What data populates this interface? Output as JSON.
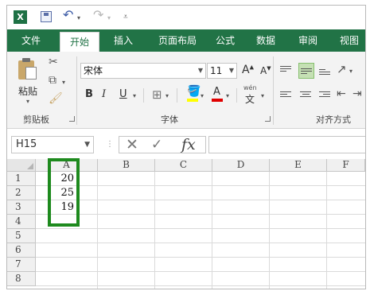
{
  "quick_access": {
    "logo": "X",
    "save_icon": "save-icon",
    "undo_icon": "undo-icon",
    "redo_icon": "redo-icon"
  },
  "tabs": [
    "文件",
    "开始",
    "插入",
    "页面布局",
    "公式",
    "数据",
    "审阅",
    "视图"
  ],
  "ribbon": {
    "clipboard": {
      "paste_label": "粘贴",
      "group_label": "剪贴板"
    },
    "font": {
      "font_name": "宋体",
      "font_size": "11",
      "grow_label": "A",
      "shrink_label": "A",
      "bold": "B",
      "italic": "I",
      "underline": "U",
      "font_color_label": "A",
      "phonetic_top": "wén",
      "phonetic_bottom": "文",
      "group_label": "字体",
      "fill_color": "#ffff00",
      "font_color": "#e00000"
    },
    "alignment": {
      "group_label": "对齐方式"
    }
  },
  "formula_bar": {
    "name_box": "H15",
    "cancel_icon": "✕",
    "enter_icon": "✓",
    "fx_label": "fx",
    "value": ""
  },
  "sheet": {
    "columns": [
      "A",
      "B",
      "C",
      "D",
      "E",
      "F"
    ],
    "rows": [
      "1",
      "2",
      "3",
      "4",
      "5",
      "6",
      "7",
      "8"
    ],
    "cells": {
      "A1": "20",
      "A2": "25",
      "A3": "19"
    }
  },
  "colors": {
    "accent": "#217346",
    "highlight_border": "#1e8a1e"
  }
}
